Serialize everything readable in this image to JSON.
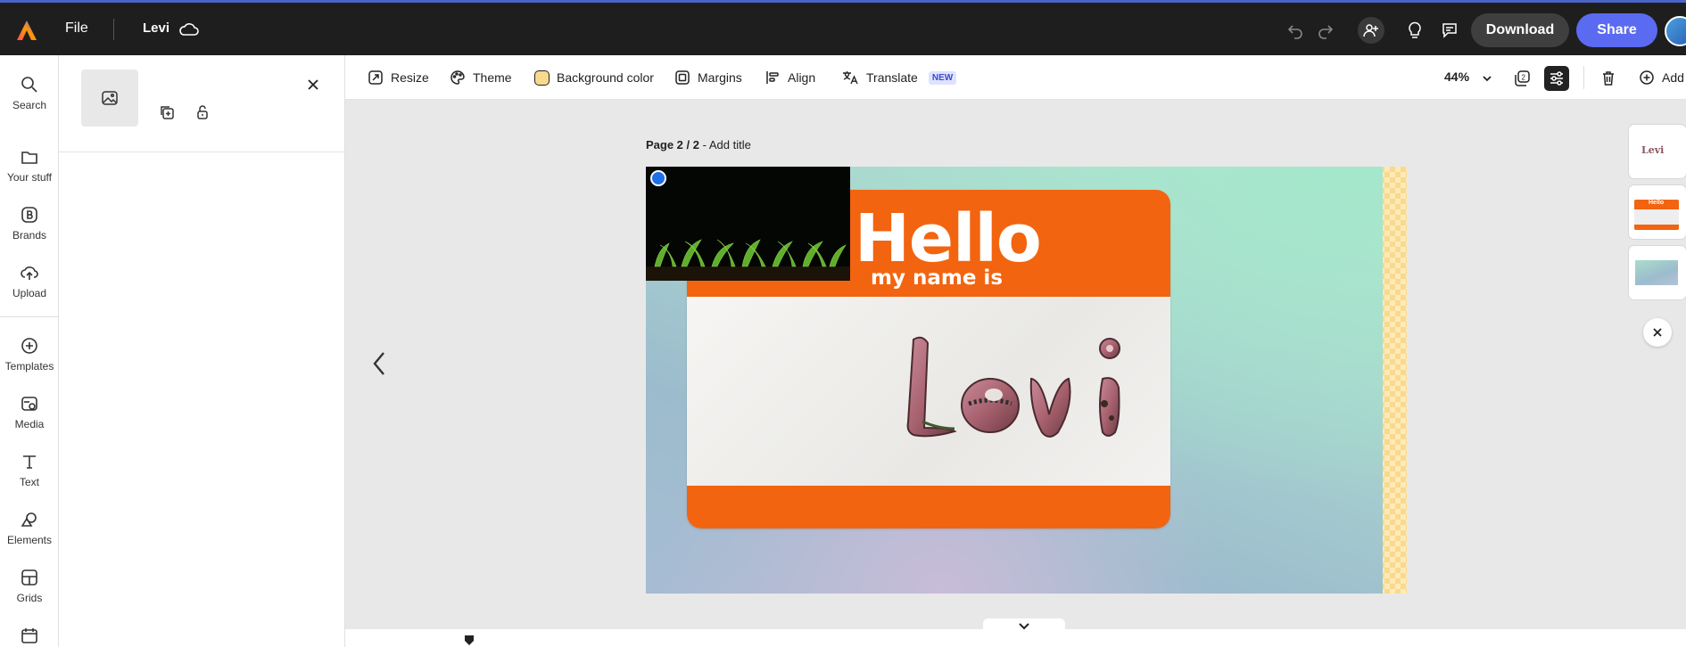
{
  "topbar": {
    "file_label": "File",
    "doc_name": "Levi",
    "download_label": "Download",
    "share_label": "Share"
  },
  "rail": {
    "items": [
      {
        "label": "Search",
        "icon": "search-icon"
      },
      {
        "label": "Your stuff",
        "icon": "folder-icon"
      },
      {
        "label": "Brands",
        "icon": "brand-icon"
      },
      {
        "label": "Upload",
        "icon": "upload-icon"
      },
      {
        "label": "Templates",
        "icon": "templates-icon"
      },
      {
        "label": "Media",
        "icon": "media-icon"
      },
      {
        "label": "Text",
        "icon": "text-icon"
      },
      {
        "label": "Elements",
        "icon": "elements-icon"
      },
      {
        "label": "Grids",
        "icon": "grids-icon"
      }
    ]
  },
  "toolbar": {
    "resize": "Resize",
    "theme": "Theme",
    "background_color": "Background color",
    "margins": "Margins",
    "align": "Align",
    "translate": "Translate",
    "new_badge": "NEW",
    "zoom": "44%",
    "add": "Add",
    "accent_color": "#5a6bf1",
    "bg_swatch_color": "#f9d98d"
  },
  "canvas": {
    "page_label": "Page 2 / 2",
    "add_title": "- Add title",
    "hello": "Hello",
    "my_name_is": "my name is",
    "name": "Levi"
  },
  "thumbnails": {
    "first_label": "Levi",
    "second_label": "Hello"
  }
}
